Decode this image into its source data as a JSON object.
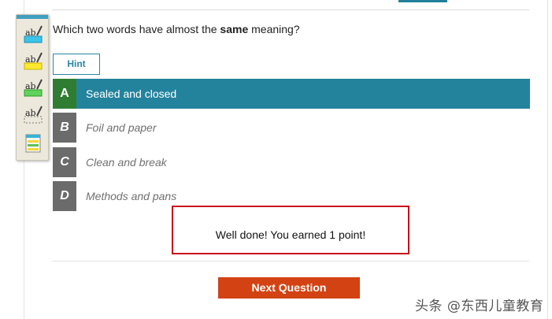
{
  "question": {
    "prefix": "Which two words have almost the ",
    "emphasis": "same",
    "suffix": " meaning?"
  },
  "hint_label": "Hint",
  "options": [
    {
      "letter": "A",
      "text": "Sealed and closed",
      "state": "selected"
    },
    {
      "letter": "B",
      "text": "Foil and paper",
      "state": "unselected"
    },
    {
      "letter": "C",
      "text": "Clean and break",
      "state": "unselected"
    },
    {
      "letter": "D",
      "text": "Methods and pans",
      "state": "unselected"
    }
  ],
  "feedback": "Well done! You earned 1 point!",
  "next_label": "Next Question",
  "watermark": "头条 @东西儿童教育",
  "toolbar": {
    "tools": [
      "highlight-blue-icon",
      "highlight-yellow-icon",
      "highlight-green-icon",
      "highlight-clear-icon",
      "notes-icon"
    ]
  },
  "colors": {
    "accent": "#24839c",
    "correct": "#2e7d32",
    "option_letter_bg": "#6b6b6b",
    "next_button": "#d24213",
    "feedback_border": "#c8101e"
  }
}
